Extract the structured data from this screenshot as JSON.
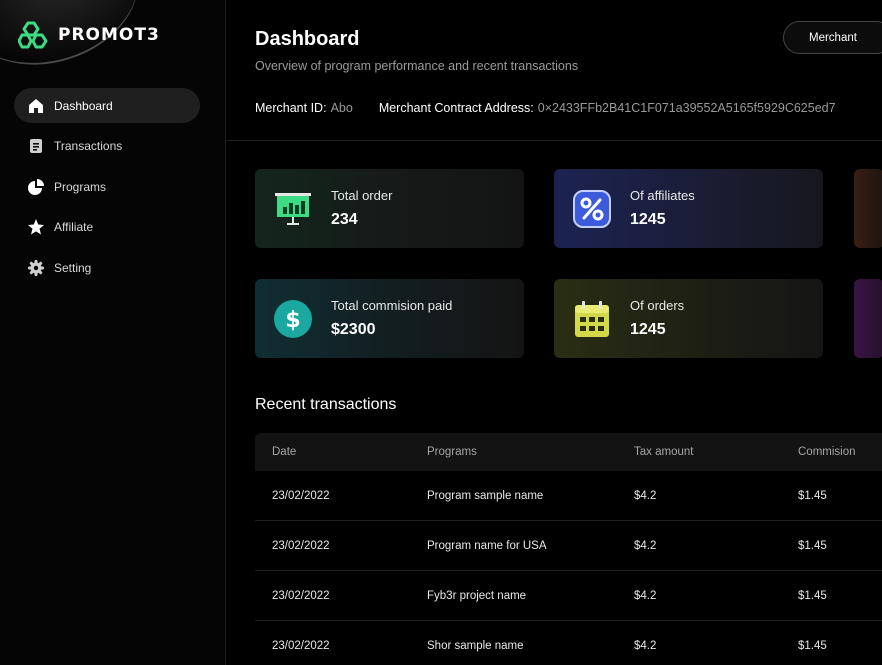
{
  "brand": {
    "name": "PROMOT3",
    "accent": "#3ddc84"
  },
  "sidebar": {
    "items": [
      {
        "label": "Dashboard",
        "icon": "home-icon",
        "active": true
      },
      {
        "label": "Transactions",
        "icon": "document-icon",
        "active": false
      },
      {
        "label": "Programs",
        "icon": "pie-chart-icon",
        "active": false
      },
      {
        "label": "Affiliate",
        "icon": "star-icon",
        "active": false
      },
      {
        "label": "Setting",
        "icon": "gear-icon",
        "active": false
      }
    ]
  },
  "header": {
    "title": "Dashboard",
    "subtitle": "Overview of program performance and recent transactions",
    "role_button": "Merchant",
    "merchant_id_label": "Merchant ID:",
    "merchant_id_value": "Abo",
    "contract_label": "Merchant Contract Address:",
    "contract_value": "0×2433FFb2B41C1F071a39552A5165f5929C625ed7"
  },
  "stats": [
    {
      "label": "Total order",
      "value": "234",
      "icon": "presentation-chart-icon",
      "color": "#3ddc84"
    },
    {
      "label": "Of affiliates",
      "value": "1245",
      "icon": "percent-icon",
      "color": "#3b5bdb"
    },
    {
      "label": "Total commision paid",
      "value": "$2300",
      "icon": "dollar-coin-icon",
      "color": "#1aa8a0"
    },
    {
      "label": "Of orders",
      "value": "1245",
      "icon": "calendar-icon",
      "color": "#d4d94a"
    }
  ],
  "transactions": {
    "title": "Recent transactions",
    "columns": [
      "Date",
      "Programs",
      "Tax amount",
      "Commision"
    ],
    "rows": [
      [
        "23/02/2022",
        "Program sample name",
        "$4.2",
        "$1.45"
      ],
      [
        "23/02/2022",
        "Program name for USA",
        "$4.2",
        "$1.45"
      ],
      [
        "23/02/2022",
        "Fyb3r project name",
        "$4.2",
        "$1.45"
      ],
      [
        "23/02/2022",
        "Shor sample name",
        "$4.2",
        "$1.45"
      ]
    ]
  }
}
